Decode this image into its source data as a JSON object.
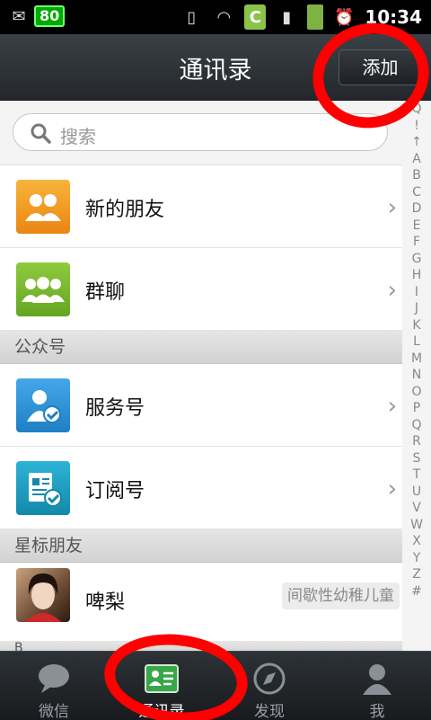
{
  "status_bar": {
    "battery_badge": "80",
    "time": "10:34",
    "c_icon": "C"
  },
  "header": {
    "title": "通讯录",
    "add_label": "添加"
  },
  "search": {
    "placeholder": "搜索"
  },
  "rows": [
    {
      "label": "新的朋友",
      "icon": "new-friends-icon",
      "color": "#f59a18"
    },
    {
      "label": "群聊",
      "icon": "group-chat-icon",
      "color": "#74b62e"
    }
  ],
  "sections": {
    "public": "公众号",
    "starred": "星标朋友",
    "b_header": "B"
  },
  "public_rows": [
    {
      "label": "服务号",
      "icon": "service-account-icon",
      "color": "#2e8fd6"
    },
    {
      "label": "订阅号",
      "icon": "subscription-account-icon",
      "color": "#1a9fc4"
    }
  ],
  "starred": [
    {
      "name": "啤梨",
      "signature": "间歇性幼稚儿童"
    }
  ],
  "index_letters": [
    "Q",
    "!",
    "↑",
    "A",
    "B",
    "C",
    "D",
    "E",
    "F",
    "G",
    "H",
    "I",
    "J",
    "K",
    "L",
    "M",
    "N",
    "O",
    "P",
    "Q",
    "R",
    "S",
    "T",
    "U",
    "V",
    "W",
    "X",
    "Y",
    "Z",
    "#"
  ],
  "tabs": [
    {
      "label": "微信",
      "icon": "chat-bubble-icon"
    },
    {
      "label": "通讯录",
      "icon": "contacts-card-icon"
    },
    {
      "label": "发现",
      "icon": "compass-icon"
    },
    {
      "label": "我",
      "icon": "person-icon"
    }
  ]
}
